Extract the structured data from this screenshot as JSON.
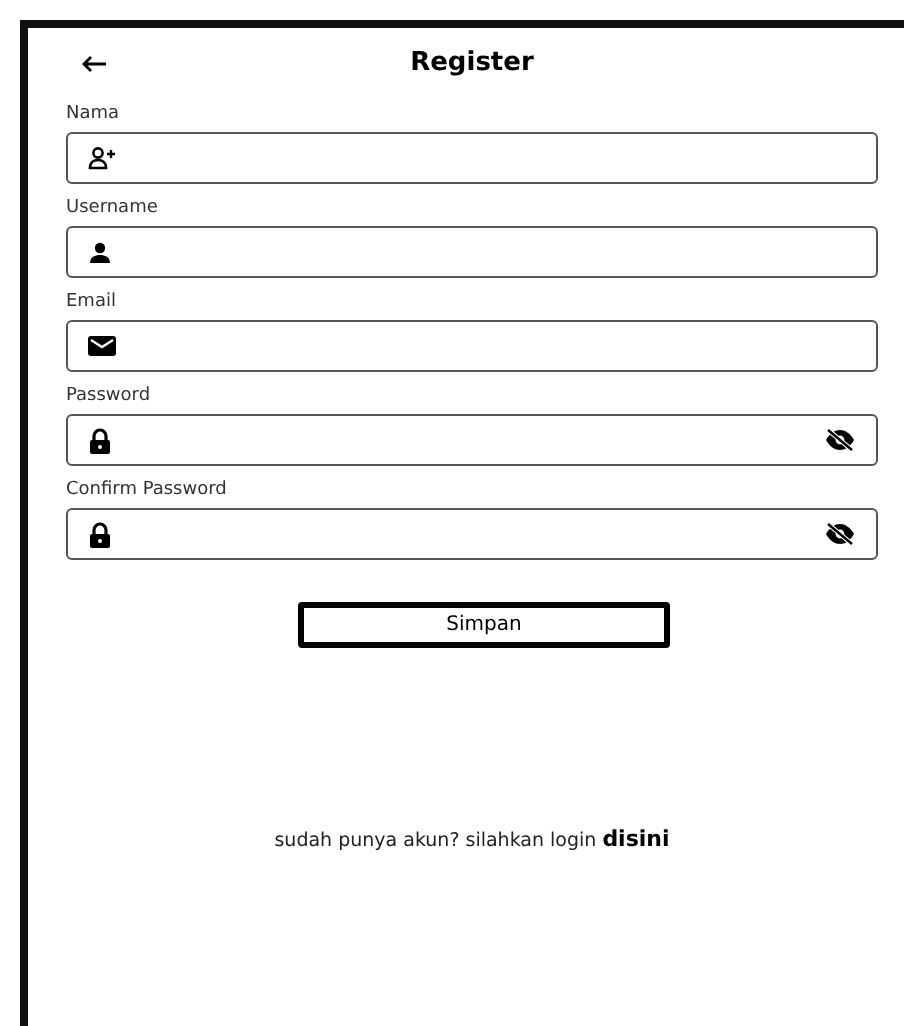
{
  "header": {
    "title": "Register"
  },
  "fields": [
    {
      "label": "Nama",
      "kind": "person-add",
      "secure": false
    },
    {
      "label": "Username",
      "kind": "person",
      "secure": false
    },
    {
      "label": "Email",
      "kind": "mail",
      "secure": false
    },
    {
      "label": "Password",
      "kind": "lock",
      "secure": true
    },
    {
      "label": "Confirm Password",
      "kind": "lock",
      "secure": true
    }
  ],
  "submit": "Simpan",
  "footer": {
    "text": "sudah punya akun? silahkan login",
    "link": "disini"
  }
}
